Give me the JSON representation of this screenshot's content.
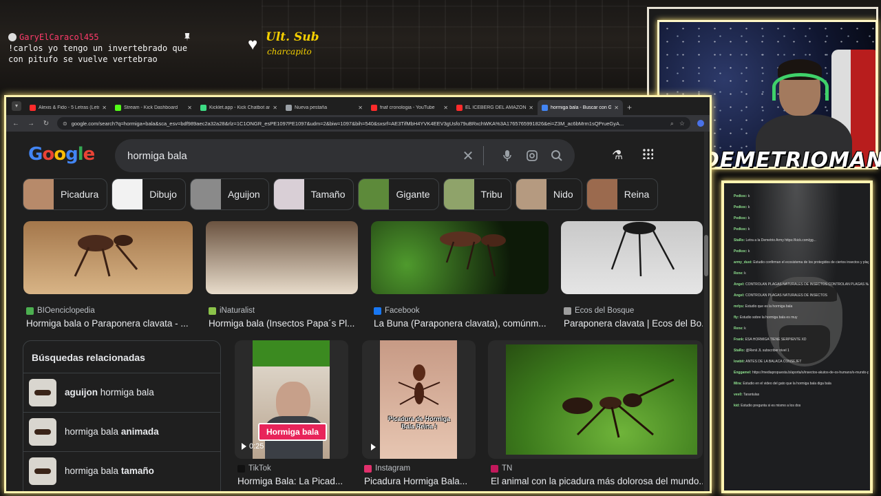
{
  "overlay": {
    "chat_user": "GaryElCaracol455",
    "chat_message": "!carlos yo tengo un invertebrado que con pitufo se vuelve vertebrao",
    "ult_sub_title": "Ult. Sub",
    "ult_sub_name": "charcapito",
    "streamer_name": "DEMETRIOMAN"
  },
  "browser": {
    "tabs": [
      {
        "title": "Alexis & Fido - 5 Letras (Letra/L",
        "color": "#ff2b2b"
      },
      {
        "title": "Stream - Kick Dashboard",
        "color": "#53fc18"
      },
      {
        "title": "Kicklet.app - Kick Chatbot and",
        "color": "#3ddc84"
      },
      {
        "title": "Nueva pestaña",
        "color": "#9aa0a6"
      },
      {
        "title": "fnaf cronologia - YouTube",
        "color": "#ff2b2b"
      },
      {
        "title": "EL ICEBERG DEL AMAZONAS",
        "color": "#ff2b2b"
      },
      {
        "title": "hormiga bala - Buscar con Goo",
        "color": "#4285f4"
      }
    ],
    "new_tab": "+",
    "url": "google.com/search?q=hormiga+bala&sca_esv=bdf989aec2a32a28&rlz=1C1ONGR_esPE1097PE1097&udm=2&biw=1097&bih=540&sxsrf=AE3TifMbH4YVK4EEV3gUsfo79uBRxchWKA%3A1765765991826&ei=Z3M_ac6bMrm1sQPrueGyA..."
  },
  "google": {
    "logo": [
      "G",
      "o",
      "o",
      "g",
      "l",
      "e"
    ],
    "query": "hormiga bala",
    "chips": [
      {
        "label": "Picadura",
        "thumb": "#b78a6a"
      },
      {
        "label": "Dibujo",
        "thumb": "#f2f2f2"
      },
      {
        "label": "Aguijon",
        "thumb": "#8a8a8a"
      },
      {
        "label": "Tamaño",
        "thumb": "#d9cfd6"
      },
      {
        "label": "Gigante",
        "thumb": "#5d8a3a"
      },
      {
        "label": "Tribu",
        "thumb": "#8fa36a"
      },
      {
        "label": "Nido",
        "thumb": "#b59a80"
      },
      {
        "label": "Reina",
        "thumb": "#9b6a4e"
      }
    ],
    "results_row1": [
      {
        "source": "BIOenciclopedia",
        "title": "Hormiga bala o Paraponera clavata - ...",
        "color": "#4caf50"
      },
      {
        "source": "iNaturalist",
        "title": "Hormiga bala (Insectos Papa´s Pl...",
        "color": "#8bc34a"
      },
      {
        "source": "Facebook",
        "title": "La Buna (Paraponera clavata), comúnm...",
        "color": "#1877f2"
      },
      {
        "source": "Ecos del Bosque",
        "title": "Paraponera clavata | Ecos del Bo...",
        "color": "#9e9e9e"
      }
    ],
    "related": {
      "heading": "Búsquedas relacionadas",
      "items": [
        {
          "bold": "aguijon",
          "rest": "hormiga bala",
          "bold_first": true
        },
        {
          "bold": "animada",
          "rest": "hormiga bala",
          "bold_first": false
        },
        {
          "bold": "tamaño",
          "rest": "hormiga bala",
          "bold_first": false
        }
      ]
    },
    "results_row2": [
      {
        "source": "TikTok",
        "title": "Hormiga Bala: La Picad...",
        "color": "#111111",
        "duration": "0:25",
        "overlay": "Hormiga bala"
      },
      {
        "source": "Instagram",
        "title": "Picadura Hormiga Bala...",
        "color": "#e1306c",
        "caption": "Picadura de Hormiga Bala Reina !"
      },
      {
        "source": "TN",
        "title": "El animal con la picadura más dolorosa del mundo...",
        "color": "#c2185b"
      }
    ]
  },
  "chat_panel": {
    "lines": [
      {
        "user": "Pedkoc:",
        "text": "k"
      },
      {
        "user": "Pedkoc:",
        "text": "k"
      },
      {
        "user": "Pedkoc:",
        "text": "k"
      },
      {
        "user": "Pedkoc:",
        "text": "k"
      },
      {
        "user": "StaRo:",
        "text": "Letra a la Demetrio Army https://kick.com/gg..."
      },
      {
        "user": "Pedkoc:",
        "text": "k"
      },
      {
        "user": "army_dust:",
        "text": "Estudio confirman el ecosistema de los protegidos de ciertos insectos y plagas sin redes habrían plagas de otros insectos"
      },
      {
        "user": "Rene:",
        "text": "k"
      },
      {
        "user": "Angel:",
        "text": "CONTROLAN PLAGAS NATURALES DE INSECTOS CONTROLAN PLAGAS NATURALES DE INSECTOS"
      },
      {
        "user": "Angel:",
        "text": "CONTROLAN PLAGAS NATURALES DE INSECTOS"
      },
      {
        "user": "mrlyu:",
        "text": "Estudio que es la hormiga bala"
      },
      {
        "user": "fly:",
        "text": "Estudio sobre la hormiga bala es muy"
      },
      {
        "user": "Rene:",
        "text": "k"
      },
      {
        "user": "Frank:",
        "text": "ESA HORMIGA TIENE SERPIENTE XD"
      },
      {
        "user": "StaRo:",
        "text": "@Renii JL subscriber nivel 1"
      },
      {
        "user": "lowbit:",
        "text": "ANTES DE LA BALACA CONSEJET"
      },
      {
        "user": "Enggamel:",
        "text": "https://mediapropuesta.b/aporta/s/insectos-akutos-de-os-humano/s-mundo-puerta-k/pinas-blancas-2015-1-30px-k/partida-1002-6d-00029-pp-pm"
      },
      {
        "user": "Mira:",
        "text": "Estudio en el video del gato que la hormiga bala diga bala"
      },
      {
        "user": "ves0:",
        "text": "Tarantulas"
      },
      {
        "user": "kid:",
        "text": "Estudio pregunta si es mismo a los dos"
      }
    ]
  }
}
